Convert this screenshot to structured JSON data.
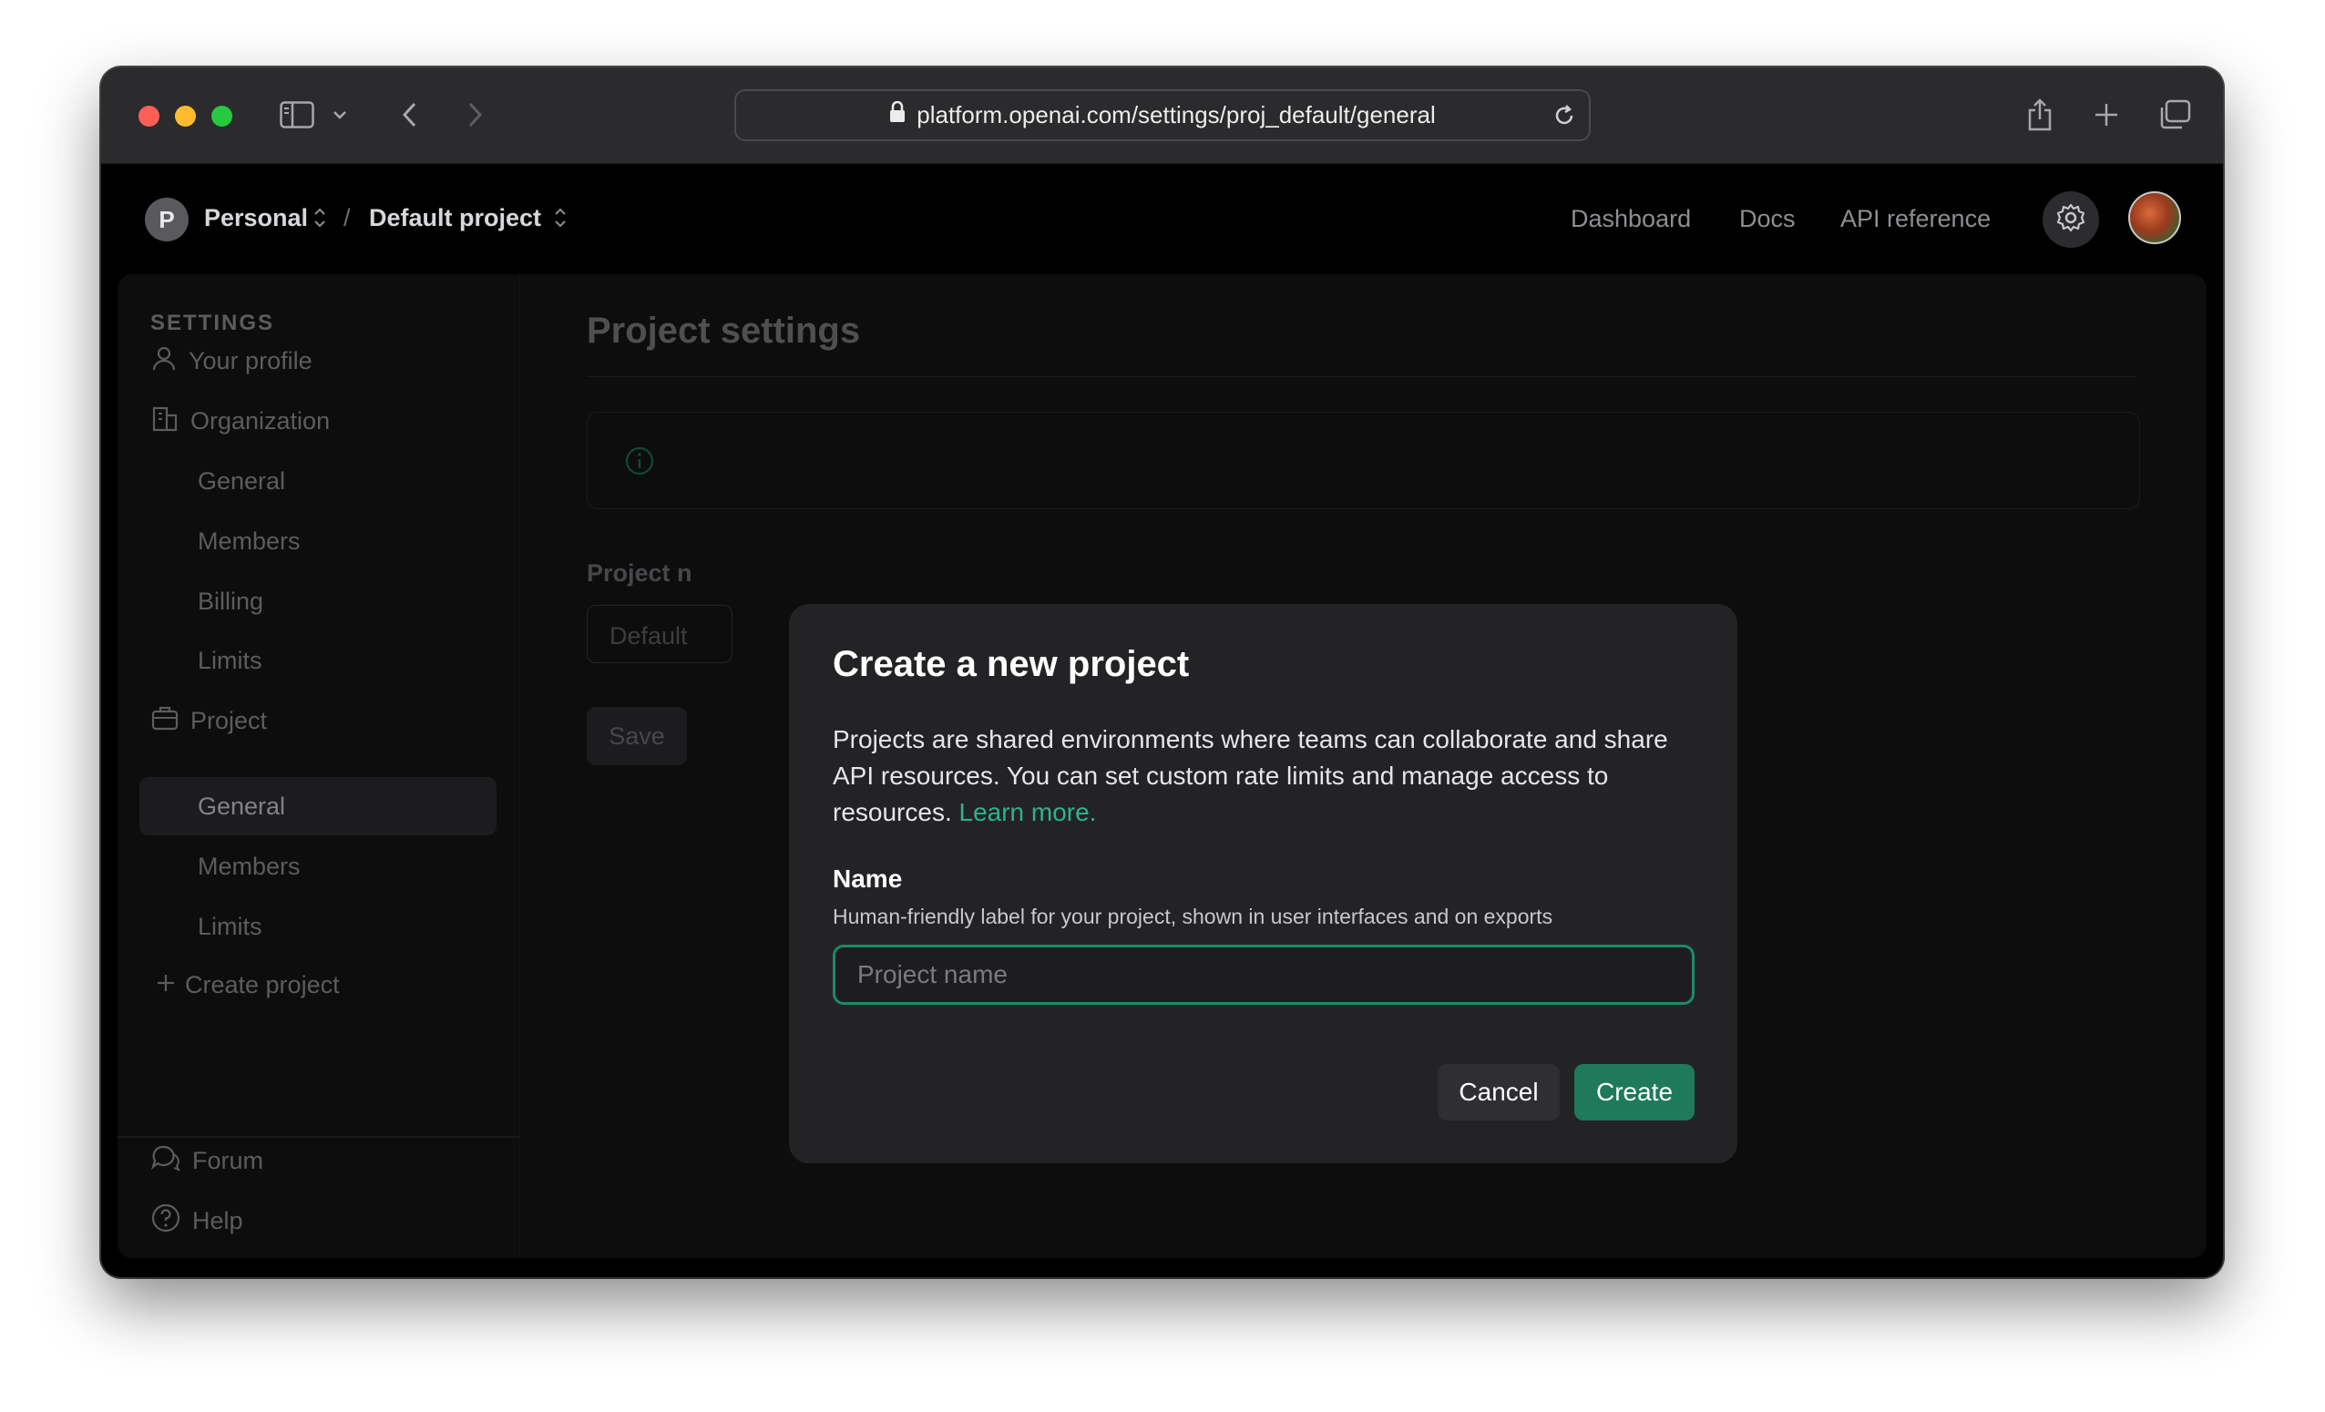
{
  "browser": {
    "url": "platform.openai.com/settings/proj_default/general",
    "icons": [
      "sidebar-toggle-icon",
      "chevron-down-icon",
      "back-icon",
      "forward-icon",
      "lock-icon",
      "reload-icon",
      "share-icon",
      "new-tab-icon",
      "tabs-overview-icon"
    ]
  },
  "topnav": {
    "org_initial": "P",
    "org_name": "Personal",
    "separator": "/",
    "project_name": "Default project",
    "links": [
      "Dashboard",
      "Docs",
      "API reference"
    ]
  },
  "sidebar": {
    "header": "SETTINGS",
    "profile": "Your profile",
    "organization": "Organization",
    "org_items": [
      "General",
      "Members",
      "Billing",
      "Limits"
    ],
    "project": "Project",
    "project_items": [
      "General",
      "Members",
      "Limits"
    ],
    "active_item": "General",
    "create_project": "Create project",
    "forum": "Forum",
    "help": "Help"
  },
  "main": {
    "title": "Project settings",
    "field_label": "Project n",
    "field_value": "Default",
    "save_label": "Save"
  },
  "modal": {
    "title": "Create a new project",
    "description": "Projects are shared environments where teams can collaborate and share API resources. You can set custom rate limits and manage access to resources.",
    "learn_more": "Learn more.",
    "name_label": "Name",
    "name_help": "Human-friendly label for your project, shown in user interfaces and on exports",
    "name_placeholder": "Project name",
    "cancel_label": "Cancel",
    "create_label": "Create"
  },
  "colors": {
    "accent": "#1e7a5a",
    "link": "#2fb28a",
    "modal_bg": "#232326",
    "page_bg": "#000000"
  }
}
